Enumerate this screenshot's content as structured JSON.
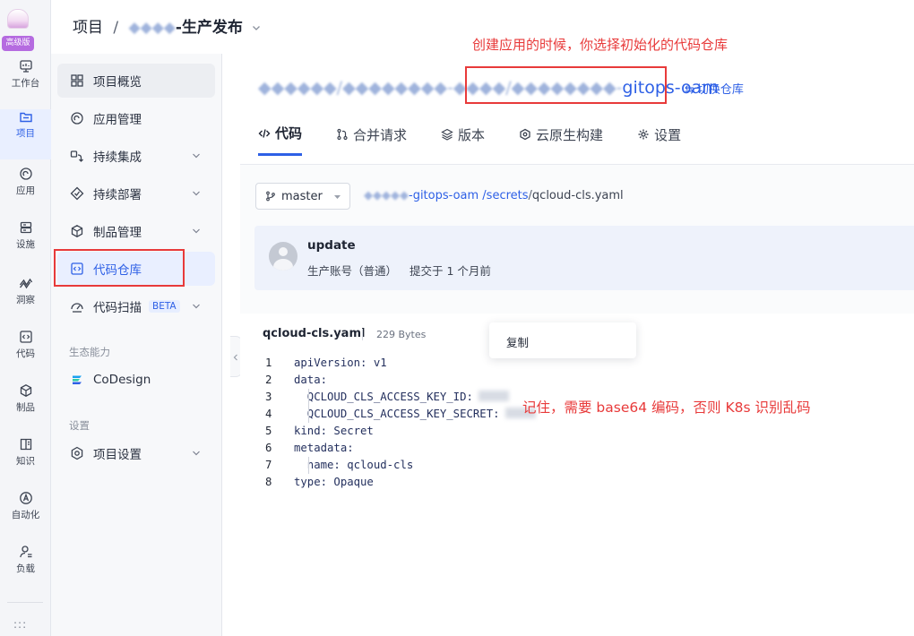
{
  "rail": {
    "edition_badge": "高级版",
    "items": [
      {
        "label": "工作台",
        "icon": "monitor-icon"
      },
      {
        "label": "项目",
        "icon": "folder-icon",
        "active": true
      },
      {
        "label": "应用",
        "icon": "app-icon"
      },
      {
        "label": "设施",
        "icon": "server-icon"
      },
      {
        "label": "洞察",
        "icon": "insight-icon"
      },
      {
        "label": "代码",
        "icon": "code-icon"
      },
      {
        "label": "制品",
        "icon": "package-icon"
      },
      {
        "label": "知识",
        "icon": "book-icon"
      },
      {
        "label": "自动化",
        "icon": "automation-icon"
      },
      {
        "label": "负载",
        "icon": "user-icon"
      }
    ],
    "more": ":::"
  },
  "header": {
    "crumb_root": "项目",
    "crumb_sep": "/",
    "project_name_mask": "◆◆◆◆",
    "project_name_suffix": "-生产发布"
  },
  "subnav": {
    "items": [
      {
        "label": "项目概览",
        "icon": "grid-icon"
      },
      {
        "label": "应用管理",
        "icon": "app-icon"
      },
      {
        "label": "持续集成",
        "icon": "ci-icon",
        "expandable": true
      },
      {
        "label": "持续部署",
        "icon": "cd-icon",
        "expandable": true
      },
      {
        "label": "制品管理",
        "icon": "package-icon",
        "expandable": true
      },
      {
        "label": "代码仓库",
        "icon": "code-icon",
        "active": true
      },
      {
        "label": "代码扫描",
        "icon": "scan-icon",
        "expandable": true,
        "badge": "BETA"
      }
    ],
    "group_ecosystem": "生态能力",
    "codesign": "CoDesign",
    "group_settings": "设置",
    "project_settings": "项目设置"
  },
  "repo": {
    "title_mask": "◆◆◆◆◆◆/◆◆◆◆◆◆◆◆-◆◆◆◆/◆◆◆◆◆◆◆◆-",
    "title_suffix": "gitops-oam",
    "switch_label": "切换仓库",
    "tabs": [
      {
        "label": "代码",
        "icon": "code-tab-icon",
        "active": true
      },
      {
        "label": "合并请求",
        "icon": "merge-request-icon"
      },
      {
        "label": "版本",
        "icon": "version-icon"
      },
      {
        "label": "云原生构建",
        "icon": "cloud-build-icon"
      },
      {
        "label": "设置",
        "icon": "settings-icon"
      }
    ]
  },
  "file_nav": {
    "branch": "master",
    "path_mask": "◆◆◆◆◆",
    "path_repo": "-gitops-oam",
    "path_dir": "/secrets",
    "path_sep": "/",
    "path_file": "qcloud-cls.yaml"
  },
  "commit": {
    "message": "update",
    "author": "生产账号（普通）",
    "time": "提交于 1 个月前"
  },
  "file": {
    "name": "qcloud-cls.yaml",
    "size": "229 Bytes",
    "copy_label": "复制",
    "lines": [
      {
        "n": "1",
        "text": "apiVersion: v1",
        "indent": false,
        "blurred_value": false
      },
      {
        "n": "2",
        "text": "data:",
        "indent": false,
        "blurred_value": false
      },
      {
        "n": "3",
        "text": "  QCLOUD_CLS_ACCESS_KEY_ID:",
        "indent": true,
        "blurred_value": true
      },
      {
        "n": "4",
        "text": "  QCLOUD_CLS_ACCESS_KEY_SECRET:",
        "indent": true,
        "blurred_value": true
      },
      {
        "n": "5",
        "text": "kind: Secret",
        "indent": false,
        "blurred_value": false
      },
      {
        "n": "6",
        "text": "metadata:",
        "indent": false,
        "blurred_value": false
      },
      {
        "n": "7",
        "text": "  name: qcloud-cls",
        "indent": true,
        "blurred_value": false
      },
      {
        "n": "8",
        "text": "type: Opaque",
        "indent": false,
        "blurred_value": false
      }
    ]
  },
  "annotations": {
    "top": "创建应用的时候，你选择初始化的代码仓库",
    "code": "记住，需要 base64 编码，否则 K8s 识别乱码"
  },
  "colors": {
    "accent": "#2e60e6",
    "annotation": "#e83a3a",
    "badge": "#b56be0"
  }
}
